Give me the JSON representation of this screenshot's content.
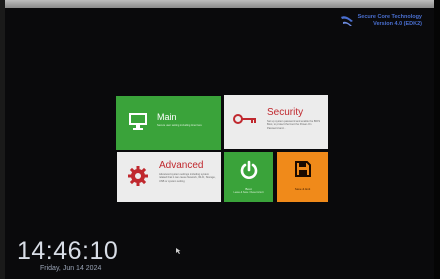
{
  "brand": {
    "line1": "Secure Core Technology",
    "line2": "Version 4.0 (EDK2)",
    "color": "#4a6fd0"
  },
  "tiles": {
    "main": {
      "title": "Main",
      "description": "Secure user setting including time here",
      "icon": "monitor-icon",
      "color": "#3aa33a"
    },
    "security": {
      "title": "Security",
      "description": "Set up system password and enable the BIOS Boot, to protect the boot the Power-On Password and...",
      "icon": "key-icon",
      "color": "#ececec"
    },
    "advanced": {
      "title": "Advanced",
      "description": "Advanced system settings including system related that it can cause Network, Wi-Fi, Storage, USB or system setting",
      "icon": "gear-icon",
      "color": "#ececec"
    },
    "power": {
      "label": "Boot",
      "sublabel": "Leave & Save / Reset & Exit",
      "icon": "power-icon",
      "color": "#3aa33a"
    },
    "save": {
      "label": "Save & Exit",
      "icon": "floppy-disk-icon",
      "color": "#f08a1a"
    }
  },
  "clock": {
    "time": "14:46:10",
    "date": "Friday, Jun 14 2024"
  }
}
